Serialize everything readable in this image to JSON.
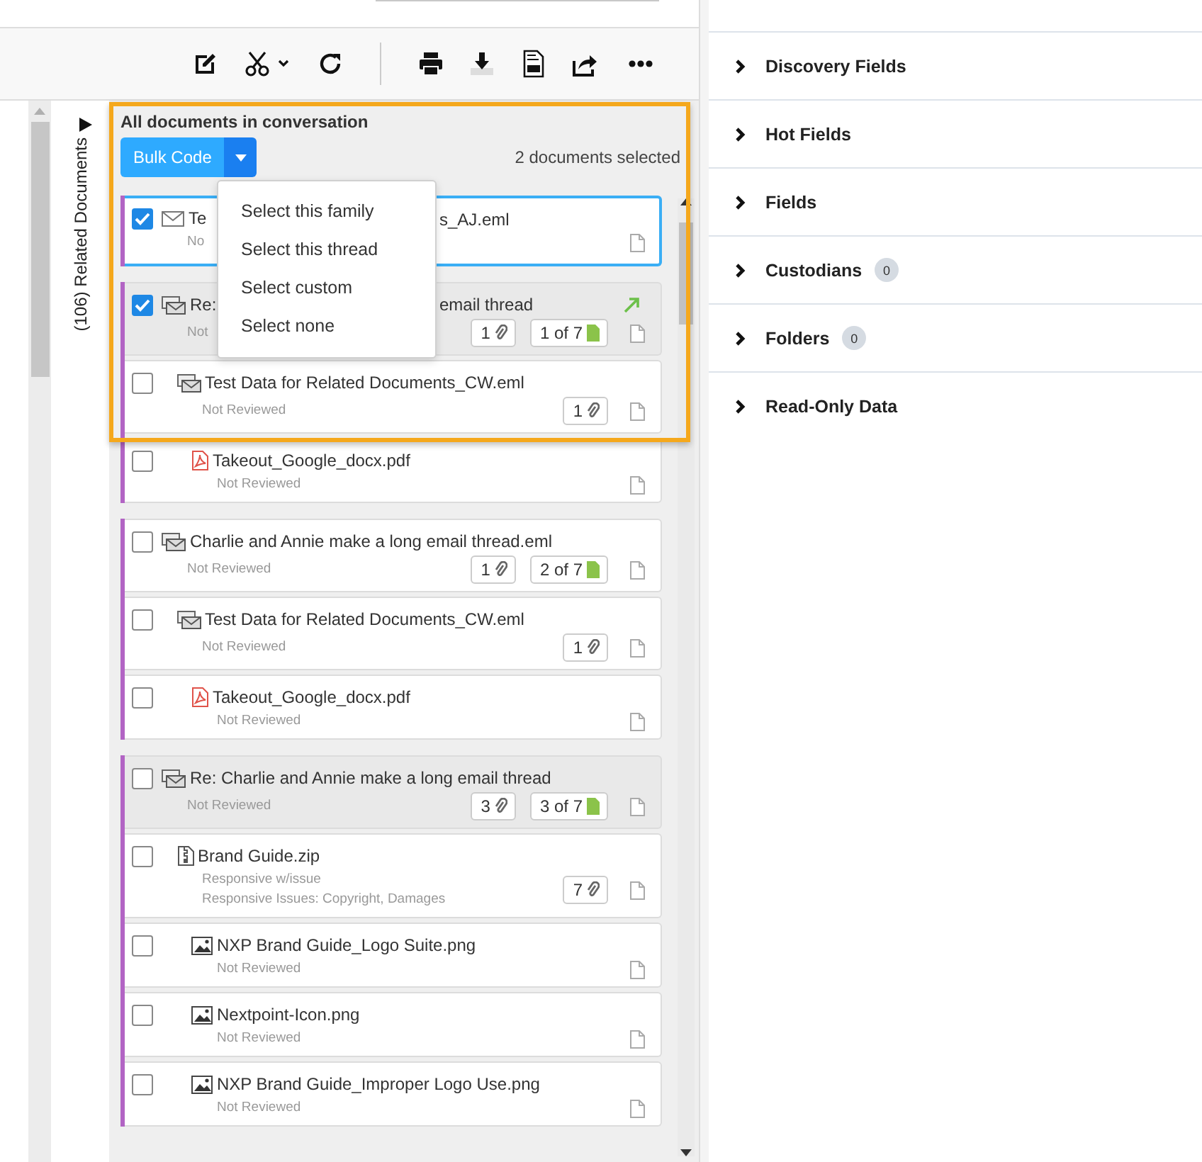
{
  "list": {
    "title": "All documents in conversation",
    "bulk_button": "Bulk Code",
    "selection_summary": "2 documents selected",
    "menu": {
      "open": true,
      "items": [
        {
          "label": "Select this family"
        },
        {
          "label": "Select this thread"
        },
        {
          "label": "Select custom"
        },
        {
          "label": "Select none"
        }
      ]
    },
    "groups": [
      {
        "docs": [
          {
            "title": "Te",
            "title_tail": "s_AJ.eml",
            "kind": "eml",
            "checked": true,
            "active": true,
            "shaded": false,
            "statuses": [
              "No"
            ]
          }
        ]
      },
      {
        "docs": [
          {
            "title": "Re:",
            "title_tail": "email thread",
            "kind": "thread",
            "checked": true,
            "active": false,
            "shaded": true,
            "linked": true,
            "statuses": [
              "Not"
            ],
            "attachments": "1",
            "thread_position": "1 of 7",
            "children": [
              {
                "title": "Test Data for Related Documents_CW.eml",
                "kind": "thread",
                "checked": false,
                "active": false,
                "shaded": false,
                "statuses": [
                  "Not Reviewed"
                ],
                "attachments": "1",
                "children": [
                  {
                    "title": "Takeout_Google_docx.pdf",
                    "kind": "pdf",
                    "checked": false,
                    "active": false,
                    "shaded": false,
                    "statuses": [
                      "Not Reviewed"
                    ]
                  }
                ]
              }
            ]
          }
        ]
      },
      {
        "docs": [
          {
            "title": "Charlie and Annie make a long email thread.eml",
            "kind": "thread",
            "checked": false,
            "active": false,
            "shaded": false,
            "statuses": [
              "Not Reviewed"
            ],
            "attachments": "1",
            "thread_position": "2 of 7",
            "children": [
              {
                "title": "Test Data for Related Documents_CW.eml",
                "kind": "thread",
                "checked": false,
                "active": false,
                "shaded": false,
                "statuses": [
                  "Not Reviewed"
                ],
                "attachments": "1",
                "children": [
                  {
                    "title": "Takeout_Google_docx.pdf",
                    "kind": "pdf",
                    "checked": false,
                    "active": false,
                    "shaded": false,
                    "statuses": [
                      "Not Reviewed"
                    ]
                  }
                ]
              }
            ]
          }
        ]
      },
      {
        "docs": [
          {
            "title": "Re: Charlie and Annie make a long email thread",
            "kind": "thread",
            "checked": false,
            "active": false,
            "shaded": true,
            "statuses": [
              "Not Reviewed"
            ],
            "attachments": "3",
            "thread_position": "3 of 7",
            "children": [
              {
                "title": "Brand Guide.zip",
                "kind": "zip",
                "checked": false,
                "active": false,
                "shaded": false,
                "statuses": [
                  "Responsive w/issue",
                  "Responsive Issues: Copyright, Damages"
                ],
                "attachments": "7",
                "children": [
                  {
                    "title": "NXP Brand Guide_Logo Suite.png",
                    "kind": "image",
                    "checked": false,
                    "active": false,
                    "shaded": false,
                    "statuses": [
                      "Not Reviewed"
                    ]
                  },
                  {
                    "title": "Nextpoint-Icon.png",
                    "kind": "image",
                    "checked": false,
                    "active": false,
                    "shaded": false,
                    "statuses": [
                      "Not Reviewed"
                    ]
                  },
                  {
                    "title": "NXP Brand Guide_Improper Logo Use.png",
                    "kind": "image",
                    "checked": false,
                    "active": false,
                    "shaded": false,
                    "statuses": [
                      "Not Reviewed"
                    ]
                  }
                ]
              }
            ]
          }
        ]
      }
    ]
  },
  "side_tab": {
    "label": "(106) Related Documents"
  },
  "right_panel": {
    "sections": [
      {
        "label": "Discovery Fields",
        "expanded": false
      },
      {
        "label": "Hot Fields",
        "expanded": false
      },
      {
        "label": "Fields",
        "expanded": false
      },
      {
        "label": "Custodians",
        "expanded": false,
        "count": "0"
      },
      {
        "label": "Folders",
        "expanded": false,
        "count": "0"
      },
      {
        "label": "Read-Only Data",
        "expanded": false
      }
    ]
  }
}
